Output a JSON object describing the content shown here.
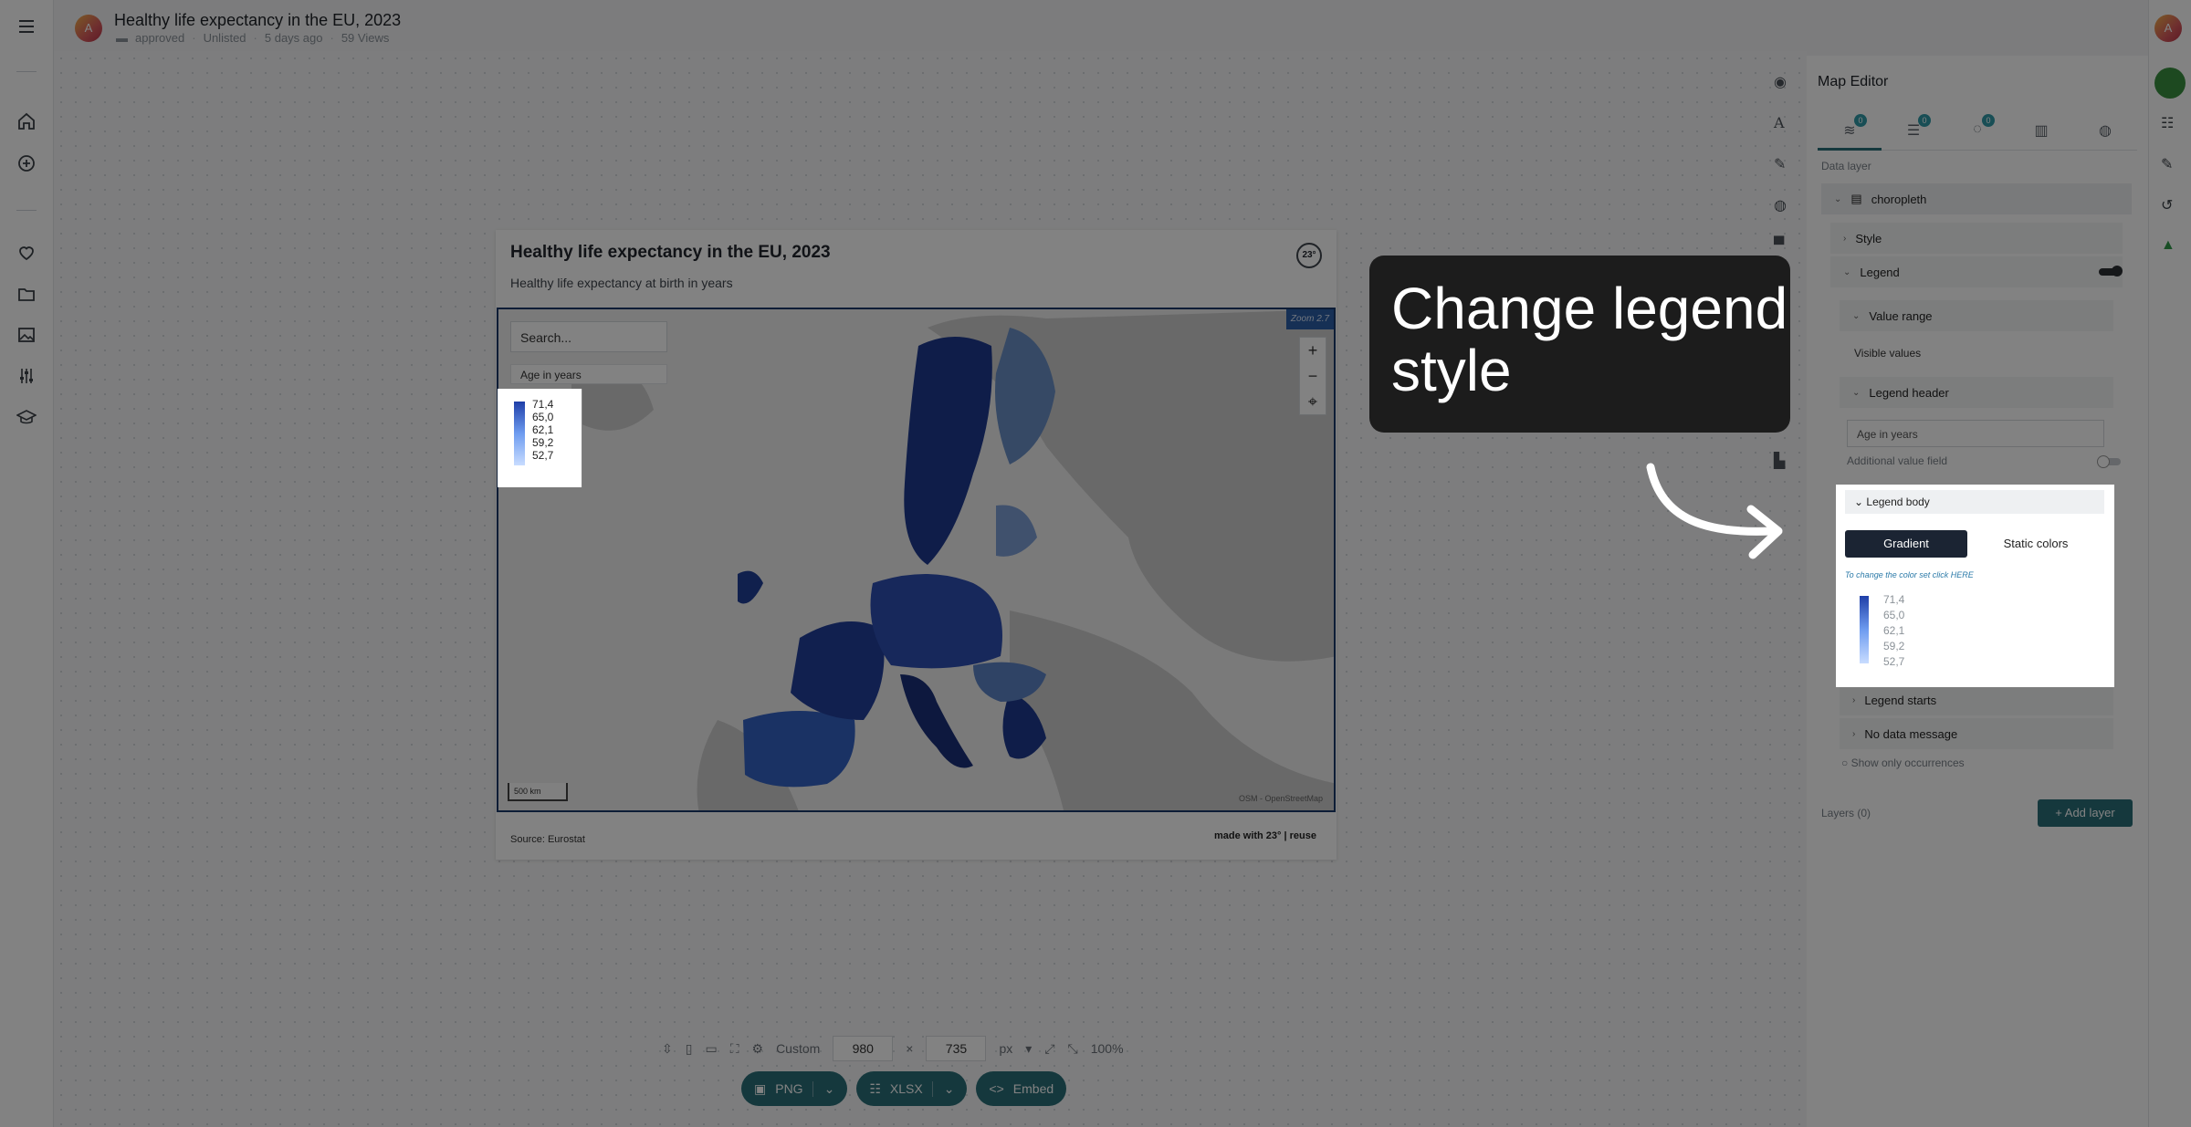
{
  "header": {
    "title": "Healthy life expectancy in the EU, 2023",
    "folder": "approved",
    "visibility": "Unlisted",
    "age": "5 days ago",
    "views": "59 Views",
    "avatar_letter": "A"
  },
  "chart": {
    "title": "Healthy life expectancy in the EU, 2023",
    "subtitle": "Healthy life expectancy at birth in years",
    "search_placeholder": "Search...",
    "legend_title": "Age in years",
    "legend_values": [
      "71,4",
      "65,0",
      "62,1",
      "59,2",
      "52,7"
    ],
    "zoom": "Zoom 2.7",
    "scale": "500 km",
    "attribution": "OSM - OpenStreetMap",
    "source": "Source: Eurostat",
    "made_with": "made with 23° | reuse",
    "logo": "23°"
  },
  "size_bar": {
    "preset": "Custom",
    "width": "980",
    "times": "×",
    "height": "735",
    "unit": "px",
    "zoom": "100%"
  },
  "export": {
    "png": "PNG",
    "xlsx": "XLSX",
    "embed": "Embed"
  },
  "editor": {
    "title": "Map Editor",
    "tab_badges": [
      "0",
      "0",
      "0"
    ],
    "data_layer_label": "Data layer",
    "layer_name": "choropleth",
    "style": "Style",
    "legend": "Legend",
    "value_range": "Value range",
    "visible_values": "Visible values",
    "legend_header": "Legend header",
    "header_value": "Age in years",
    "additional_value_field": "Additional value field",
    "legend_body": "Legend body",
    "gradient": "Gradient",
    "static_colors": "Static colors",
    "color_hint": "To change the color set click HERE",
    "legend_starts": "Legend starts",
    "no_data_message": "No data message",
    "show_only_occurrences": "Show only occurrences",
    "layers": "Layers (0)",
    "add_layer": "+ Add layer"
  },
  "callout": {
    "line1": "Change legend",
    "line2": "style"
  },
  "colors": {
    "accent": "#2a6e78",
    "dark": "#1b2433",
    "map_dark": "#1f3fa8",
    "map_light": "#c8dcff"
  }
}
